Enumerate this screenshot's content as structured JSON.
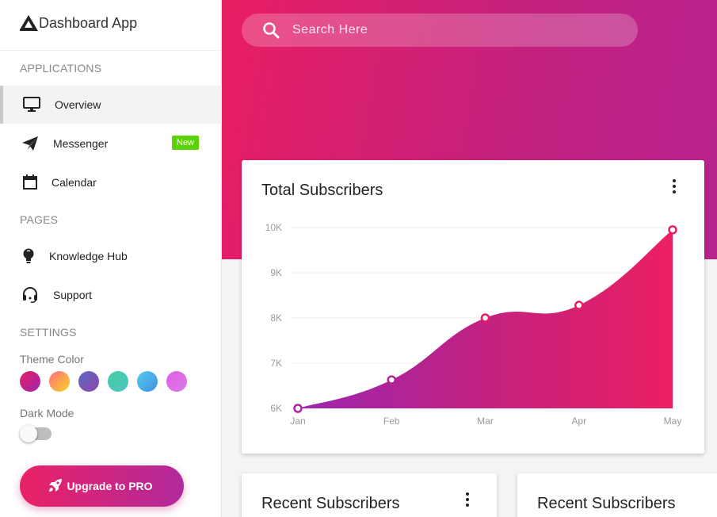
{
  "app": {
    "title": "Dashboard App"
  },
  "sidebar": {
    "sections": {
      "applications": "APPLICATIONS",
      "pages": "PAGES",
      "settings": "SETTINGS"
    },
    "items": [
      {
        "label": "Overview",
        "icon": "monitor-icon",
        "active": true
      },
      {
        "label": "Messenger",
        "icon": "paper-plane-icon",
        "badge": "New"
      },
      {
        "label": "Calendar",
        "icon": "calendar-icon"
      },
      {
        "label": "Knowledge Hub",
        "icon": "lightbulb-icon"
      },
      {
        "label": "Support",
        "icon": "headset-icon"
      }
    ],
    "theme_color_label": "Theme Color",
    "theme_colors": [
      {
        "name": "pink-purple",
        "from": "#e91e63",
        "to": "#9c27b0"
      },
      {
        "name": "orange-yellow",
        "from": "#ff6e7f",
        "to": "#f9d423"
      },
      {
        "name": "indigo",
        "from": "#5c6bc0",
        "to": "#8e44ad"
      },
      {
        "name": "teal",
        "from": "#43cea2",
        "to": "#4fc3c0"
      },
      {
        "name": "blue",
        "from": "#56ccf2",
        "to": "#3f8fdc"
      },
      {
        "name": "violet",
        "from": "#e65ce6",
        "to": "#d67be6"
      }
    ],
    "dark_mode_label": "Dark Mode",
    "dark_mode_on": false,
    "upgrade_label": "Upgrade to PRO"
  },
  "search": {
    "placeholder": "Search Here"
  },
  "cards": {
    "total_subscribers_title": "Total Subscribers",
    "recent_subscribers_title": "Recent Subscribers",
    "recent_subscribers_title_2": "Recent Subscribers"
  },
  "colors": {
    "accent_pink": "#e91e63",
    "accent_purple": "#9c27b0",
    "badge_green": "#5ad300"
  },
  "chart_data": {
    "type": "area",
    "title": "Total Subscribers",
    "categories": [
      "Jan",
      "Feb",
      "Mar",
      "Apr",
      "May"
    ],
    "series": [
      {
        "values": [
          6000,
          6630,
          8000,
          8280,
          9950
        ]
      }
    ],
    "ylim": [
      6000,
      10000
    ],
    "yticks": [
      10000,
      9000,
      8000,
      7000,
      6000
    ],
    "ytick_labels": [
      "10K",
      "9K",
      "8K",
      "7K",
      "6K"
    ],
    "grid": true
  }
}
